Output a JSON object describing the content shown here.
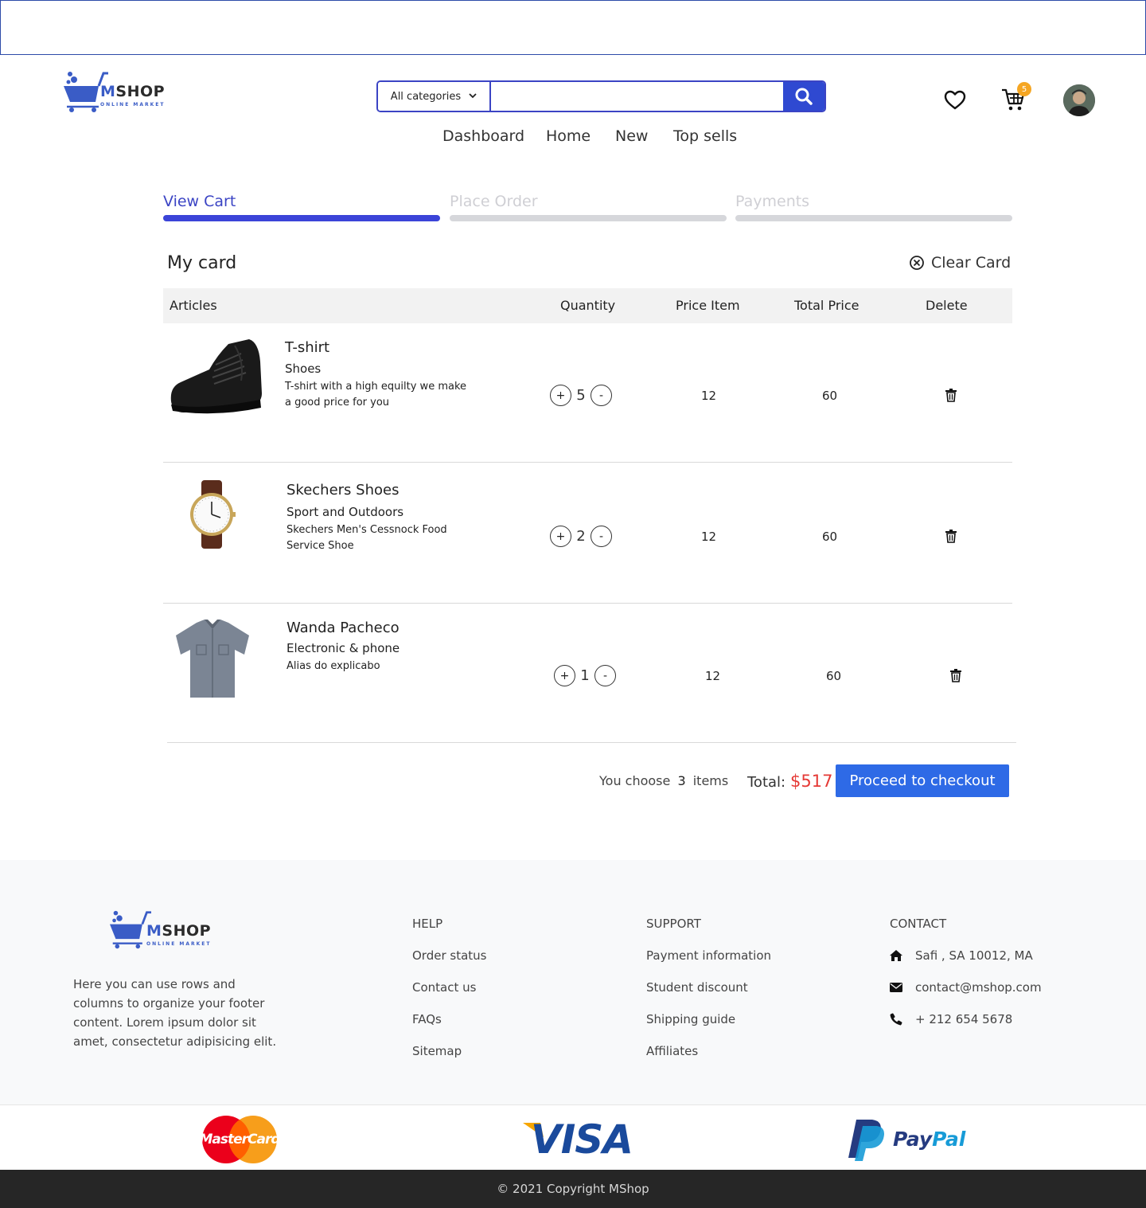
{
  "header": {
    "logo": {
      "brand_m": "M",
      "brand_rest": "SHOP",
      "tagline": "ONLINE MARKET"
    },
    "search": {
      "category": "All categories",
      "placeholder": "",
      "value": ""
    },
    "nav": [
      "Dashboard",
      "Home",
      "New",
      "Top sells"
    ],
    "cart_count": "5"
  },
  "steps": [
    {
      "label": "View Cart",
      "active": true
    },
    {
      "label": "Place Order",
      "active": false
    },
    {
      "label": "Payments",
      "active": false
    }
  ],
  "cart": {
    "title": "My card",
    "clear_label": "Clear Card",
    "columns": [
      "Articles",
      "Quantity",
      "Price Item",
      "Total Price",
      "Delete"
    ],
    "items": [
      {
        "name": "T-shirt",
        "category": "Shoes",
        "description": "T-shirt with a high equilty we make a good price for you",
        "quantity": "5",
        "price": "12",
        "total": "60",
        "plus": "+",
        "minus": "-"
      },
      {
        "name": "Skechers Shoes",
        "category": "Sport and Outdoors",
        "description": "Skechers Men's Cessnock Food Service Shoe",
        "quantity": "2",
        "price": "12",
        "total": "60",
        "plus": "+",
        "minus": "-"
      },
      {
        "name": "Wanda Pacheco",
        "category": "Electronic & phone",
        "description": "Alias do explicabo",
        "quantity": "1",
        "price": "12",
        "total": "60",
        "plus": "+",
        "minus": "-"
      }
    ],
    "summary": {
      "choose_prefix": "You choose",
      "count": "3",
      "choose_suffix": "items",
      "total_label": "Total:",
      "total_value": "$517",
      "checkout_label": "Proceed to checkout"
    }
  },
  "footer": {
    "logo": {
      "brand_m": "M",
      "brand_rest": "SHOP",
      "tagline": "ONLINE MARKET"
    },
    "description": "Here you can use rows and columns to organize your footer content. Lorem ipsum dolor sit amet, consectetur adipisicing elit.",
    "help": {
      "heading": "HELP",
      "links": [
        "Order status",
        "Contact us",
        "FAQs",
        "Sitemap"
      ]
    },
    "support": {
      "heading": "SUPPORT",
      "links": [
        "Payment information",
        "Student discount",
        "Shipping guide",
        "Affiliates"
      ]
    },
    "contact": {
      "heading": "CONTACT",
      "address": "Safi , SA 10012, MA",
      "email": "contact@mshop.com",
      "phone": "+ 212 654 5678"
    },
    "payments": {
      "mastercard": "MasterCard",
      "visa": "VISA",
      "paypal_pay": "Pay",
      "paypal_pal": "Pal"
    },
    "copyright": "© 2021 Copyright MShop"
  },
  "colors": {
    "accent": "#3b44c4",
    "checkout": "#2e6ae6",
    "total": "#e53935",
    "badge": "#f5a623"
  }
}
